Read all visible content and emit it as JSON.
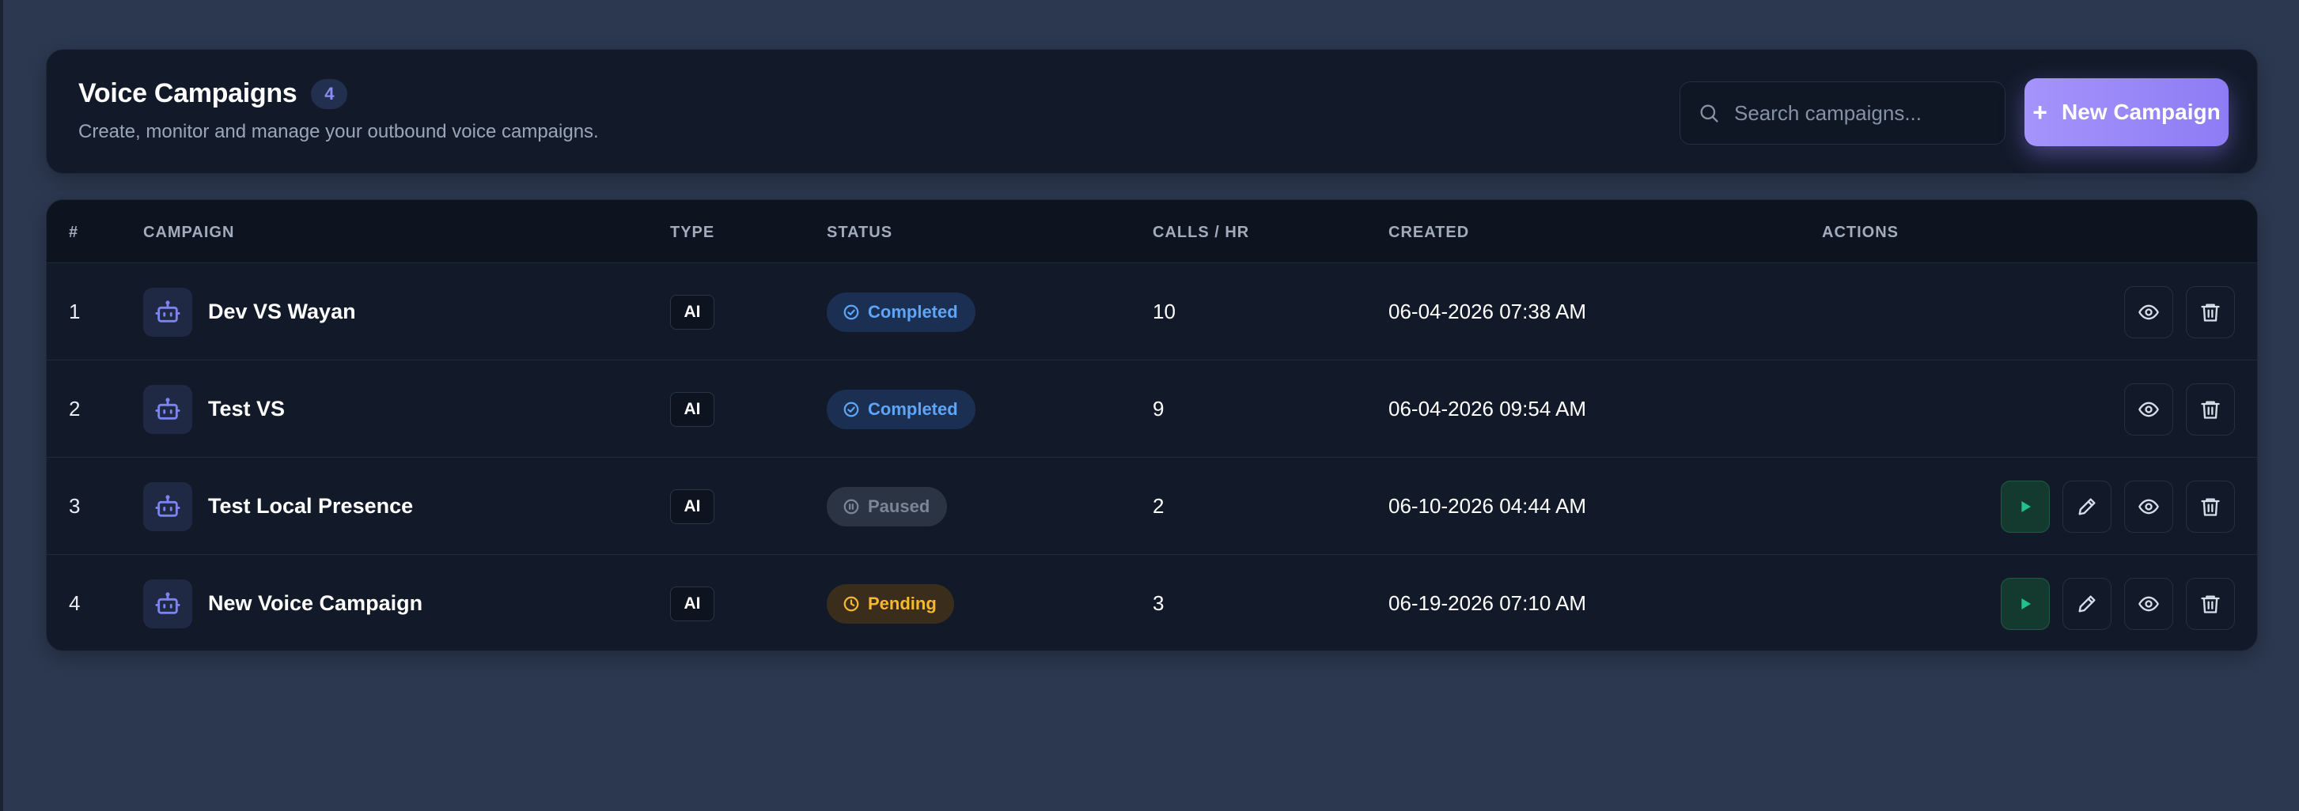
{
  "header": {
    "title": "Voice Campaigns",
    "count": "4",
    "subtitle": "Create, monitor and manage your outbound voice campaigns.",
    "search_placeholder": "Search campaigns...",
    "search_value": "",
    "new_button_icon": "+",
    "new_button_label": "New Campaign"
  },
  "colors": {
    "accent": "#8d7cf5",
    "completed": "#5ea5f8",
    "paused": "#7a8597",
    "pending": "#f5b82e",
    "play": "#22c08a"
  },
  "table": {
    "columns": [
      "#",
      "CAMPAIGN",
      "TYPE",
      "STATUS",
      "CALLS / HR",
      "CREATED",
      "ACTIONS"
    ],
    "rows": [
      {
        "num": "1",
        "name": "Dev VS Wayan",
        "type": "AI",
        "status": "Completed",
        "calls": "10",
        "created": "06-04-2026 07:38 AM",
        "actions": [
          "view",
          "delete"
        ]
      },
      {
        "num": "2",
        "name": "Test VS",
        "type": "AI",
        "status": "Completed",
        "calls": "9",
        "created": "06-04-2026 09:54 AM",
        "actions": [
          "view",
          "delete"
        ]
      },
      {
        "num": "3",
        "name": "Test Local Presence",
        "type": "AI",
        "status": "Paused",
        "calls": "2",
        "created": "06-10-2026 04:44 AM",
        "actions": [
          "play",
          "edit",
          "view",
          "delete"
        ]
      },
      {
        "num": "4",
        "name": "New Voice Campaign",
        "type": "AI",
        "status": "Pending",
        "calls": "3",
        "created": "06-19-2026 07:10 AM",
        "actions": [
          "play",
          "edit",
          "view",
          "delete"
        ]
      }
    ]
  },
  "icons": {
    "search": "search-icon",
    "campaign": "robot-icon",
    "completed": "check-circle-icon",
    "paused": "pause-circle-icon",
    "pending": "clock-icon",
    "play": "play-icon",
    "edit": "pencil-icon",
    "view": "eye-icon",
    "delete": "trash-icon"
  }
}
